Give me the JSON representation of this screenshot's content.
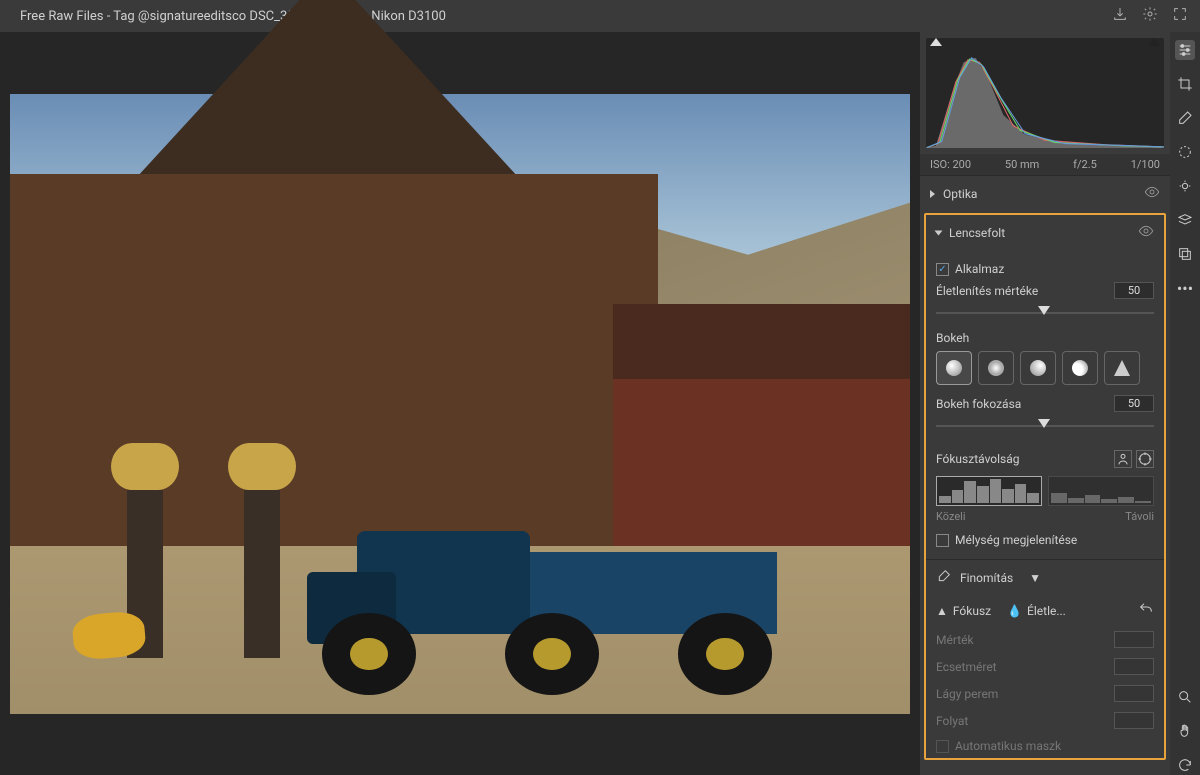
{
  "title": "Free Raw Files - Tag @signatureeditsco DSC_3500 (3) 1.nef  -  Nikon D3100",
  "meta": {
    "iso": "ISO: 200",
    "focal": "50 mm",
    "aperture": "f/2.5",
    "shutter": "1/100"
  },
  "sections": {
    "optika": {
      "label": "Optika"
    },
    "lencsefolt": {
      "label": "Lencsefolt",
      "apply": "Alkalmaz",
      "blur_label": "Életlenítés mértéke",
      "blur_value": "50",
      "bokeh_label": "Bokeh",
      "bokeh_enhance_label": "Bokeh fokozása",
      "bokeh_enhance_value": "50",
      "focus_dist_label": "Fókusztávolság",
      "near": "Közeli",
      "far": "Távoli",
      "show_depth": "Mélység megjelenítése"
    },
    "finomitas": {
      "label": "Finomítás",
      "tabs": {
        "fokusz": "Fókusz",
        "eletle": "Életle..."
      },
      "rows": {
        "mertek": "Mérték",
        "ecset": "Ecsetméret",
        "perem": "Lágy perem",
        "folyat": "Folyat",
        "automask": "Automatikus maszk"
      }
    }
  }
}
